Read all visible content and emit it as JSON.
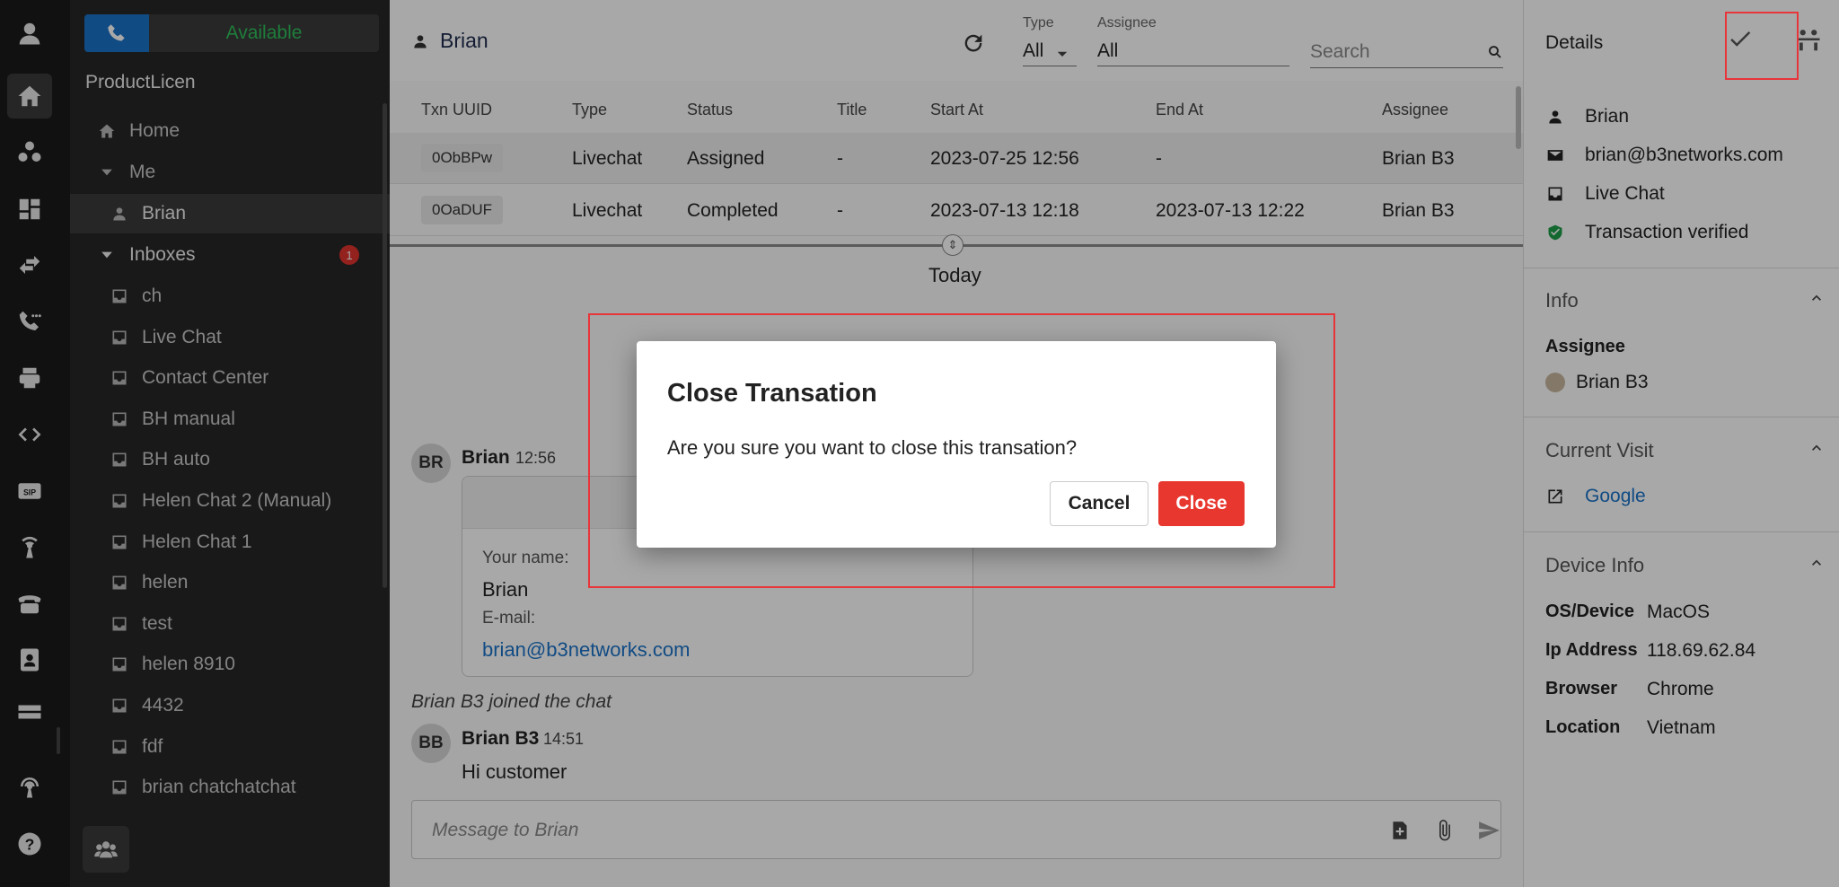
{
  "presence": {
    "status_label": "Available"
  },
  "sidebar": {
    "org_name": "ProductLicen",
    "home_label": "Home",
    "me_label": "Me",
    "me_child": "Brian",
    "inboxes_label": "Inboxes",
    "inboxes_badge": "1",
    "inboxes": [
      "ch",
      "Live Chat",
      "Contact Center",
      "BH manual",
      "BH auto",
      "Helen Chat 2 (Manual)",
      "Helen Chat 1",
      "helen",
      "test",
      "helen 8910",
      "4432",
      "fdf",
      "brian chatchatchat"
    ]
  },
  "header": {
    "contact_name": "Brian",
    "type_label": "Type",
    "type_value": "All",
    "assignee_label": "Assignee",
    "assignee_value": "All",
    "search_placeholder": "Search"
  },
  "table": {
    "columns": [
      "Txn UUID",
      "Type",
      "Status",
      "Title",
      "Start At",
      "End At",
      "Assignee"
    ],
    "rows": [
      {
        "uuid": "0ObBPw",
        "type": "Livechat",
        "status": "Assigned",
        "title": "-",
        "start": "2023-07-25 12:56",
        "end": "-",
        "assignee": "Brian B3"
      },
      {
        "uuid": "0OaDUF",
        "type": "Livechat",
        "status": "Completed",
        "title": "-",
        "start": "2023-07-13 12:18",
        "end": "2023-07-13 12:22",
        "assignee": "Brian B3"
      }
    ]
  },
  "chat": {
    "day_label": "Today",
    "msg1": {
      "initials": "BR",
      "author": "Brian",
      "time": "12:56"
    },
    "form": {
      "name_label": "Your name:",
      "name_value": "Brian",
      "email_label": "E-mail:",
      "email_value": "brian@b3networks.com"
    },
    "system_note": "Brian B3 joined the chat",
    "msg2": {
      "initials": "BB",
      "author": "Brian B3",
      "time": "14:51",
      "text": "Hi customer"
    },
    "composer_placeholder": "Message to Brian"
  },
  "details": {
    "title": "Details",
    "name": "Brian",
    "email": "brian@b3networks.com",
    "channel": "Live Chat",
    "verified": "Transaction verified",
    "info_title": "Info",
    "assignee_key": "Assignee",
    "assignee_value": "Brian B3",
    "visit_title": "Current Visit",
    "visit_link": "Google",
    "device_title": "Device Info",
    "device": [
      {
        "key": "OS/Device",
        "value": "MacOS"
      },
      {
        "key": "Ip Address",
        "value": "118.69.62.84"
      },
      {
        "key": "Browser",
        "value": "Chrome"
      },
      {
        "key": "Location",
        "value": "Vietnam"
      }
    ]
  },
  "dialog": {
    "title": "Close Transation",
    "body": "Are you sure you want to close this transation?",
    "cancel_label": "Cancel",
    "close_label": "Close"
  },
  "colors": {
    "accent_blue": "#1a73c8",
    "available_green": "#2ebf5a",
    "danger_red": "#e8372f",
    "verified_green": "#1e9e4a"
  }
}
